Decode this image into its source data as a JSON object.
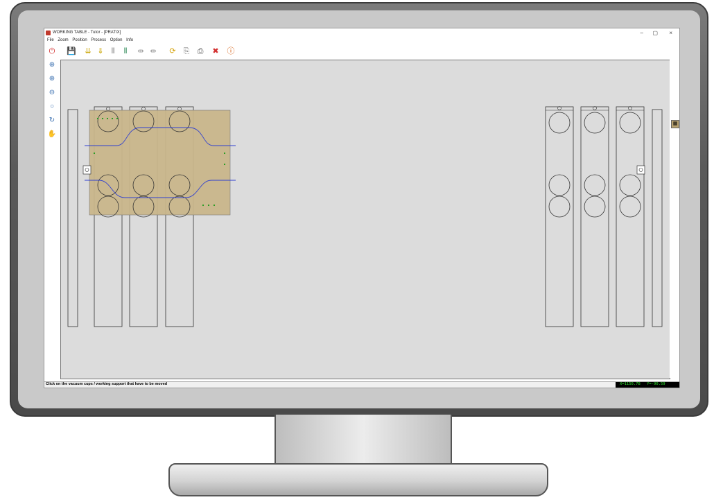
{
  "window": {
    "title": "WORKING TABLE - Tutor - [PRATIX]",
    "minimize": "–",
    "restore": "▢",
    "close": "×"
  },
  "menu": [
    "File",
    "Zoom",
    "Position",
    "Process",
    "Option",
    "Info"
  ],
  "toolbar": [
    {
      "name": "power-icon",
      "glyph": "⏻",
      "color": "#d32f2f"
    },
    {
      "name": "save-icon",
      "glyph": "💾",
      "color": "#555555"
    },
    {
      "name": "move-down-icon",
      "glyph": "⇊",
      "color": "#c9a400"
    },
    {
      "name": "move-down-2-icon",
      "glyph": "⇓",
      "color": "#c9a400"
    },
    {
      "name": "align-bars-icon",
      "glyph": "⫴",
      "color": "#777777"
    },
    {
      "name": "align-bars-2-icon",
      "glyph": "⫴",
      "color": "#2e8b57"
    },
    {
      "name": "spread-icon",
      "glyph": "⇹",
      "color": "#999999"
    },
    {
      "name": "spread-2-icon",
      "glyph": "⇹",
      "color": "#999999"
    },
    {
      "name": "refresh-icon",
      "glyph": "⟳",
      "color": "#d4a000"
    },
    {
      "name": "copy-icon",
      "glyph": "⎘",
      "color": "#777777"
    },
    {
      "name": "print-icon",
      "glyph": "⎙",
      "color": "#555555"
    },
    {
      "name": "remove-support-icon",
      "glyph": "✖",
      "color": "#d32f2f"
    },
    {
      "name": "info-icon",
      "glyph": "ⓘ",
      "color": "#d35400"
    }
  ],
  "side_tools": [
    {
      "name": "zoom-in-icon",
      "glyph": "⊕"
    },
    {
      "name": "zoom-window-icon",
      "glyph": "⊕"
    },
    {
      "name": "zoom-out-icon",
      "glyph": "⊖"
    },
    {
      "name": "zoom-all-icon",
      "glyph": "○"
    },
    {
      "name": "zoom-refresh-icon",
      "glyph": "↻"
    },
    {
      "name": "pan-hand-icon",
      "glyph": "✋"
    }
  ],
  "status": {
    "message": "Click on the vacuum cups / working support that have to be moved",
    "x": "X=1150.78",
    "y": "Y=-90.59"
  },
  "colors": {
    "workpiece": "#c8b58a",
    "canvas": "#dcdcdc",
    "cut_path": "#2f3fd0",
    "markers": "#1a9a1a"
  }
}
